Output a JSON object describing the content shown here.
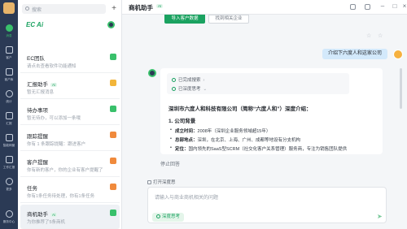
{
  "rail": {
    "items": [
      {
        "label": "消息",
        "icon": "chat-icon"
      },
      {
        "label": "客户",
        "icon": "customer-icon"
      },
      {
        "label": "客户库",
        "icon": "customer-library-icon"
      },
      {
        "label": "统计",
        "icon": "statistics-icon"
      },
      {
        "label": "汇报",
        "icon": "report-icon"
      },
      {
        "label": "智能网营",
        "icon": "marketing-icon"
      },
      {
        "label": "工作汇报",
        "icon": "work-report-icon"
      },
      {
        "label": "更多",
        "icon": "more-icon"
      },
      {
        "label": "服务中心",
        "icon": "service-center-icon"
      }
    ]
  },
  "list": {
    "search_placeholder": "搜索",
    "ec_ai_label": "EC Ai",
    "conversations": [
      {
        "title": "EC团队",
        "preview": "请点击查看软件功能通知",
        "badge": "",
        "color": "#39c06b"
      },
      {
        "title": "汇报助手",
        "preview": "暂无汇报消息",
        "badge": "Ai",
        "color": "#f2b53a"
      },
      {
        "title": "待办事项",
        "preview": "暂无待办，可以添加一条哦",
        "badge": "",
        "color": "#39c06b"
      },
      {
        "title": "跟踪提醒",
        "preview": "你有 1 条跟踪提醒：跟进客户",
        "badge": "",
        "color": "#f08a3c"
      },
      {
        "title": "客户提醒",
        "preview": "你有新的客户，你的企业有客户提醒了",
        "badge": "",
        "color": "#f08a3c"
      },
      {
        "title": "任务",
        "preview": "你有1条任务待处理，你有1条任务",
        "badge": "",
        "color": "#f08a3c"
      },
      {
        "title": "商机助手",
        "preview": "为你推荐了5条商机",
        "badge": "Ai",
        "color": "#39c06b"
      }
    ]
  },
  "main": {
    "app_title": "商机助手",
    "ai_badge": "AI",
    "chip_primary": "导入客户数据",
    "chip_secondary": "找到相关企业",
    "user_message": "介绍下六度人和这家公司",
    "thinking": {
      "step1": "已完成搜索",
      "step2": "已深度思考"
    },
    "answer": {
      "heading": "深圳市六度人和科技有限公司（简称“六度人和”）深度介绍：",
      "section": "1. 公司背景",
      "bullets": [
        {
          "key": "成立时间：",
          "value": "2008年（深圳企业服务领域超15年）"
        },
        {
          "key": "总部地点：",
          "value": "深圳，在北京、上海、广州、成都等地设有分支机构"
        },
        {
          "key": "定位：",
          "value": "国内领先的SaaS型SCRM（社交化客户关系管理）服务商，专注为销售团队提供"
        }
      ]
    },
    "stop_label": "停止回答",
    "deep_think_toggle": "打开深度思",
    "input_placeholder": "请输入与商业商机相关的问题",
    "deep_think_button": "深度思考"
  }
}
